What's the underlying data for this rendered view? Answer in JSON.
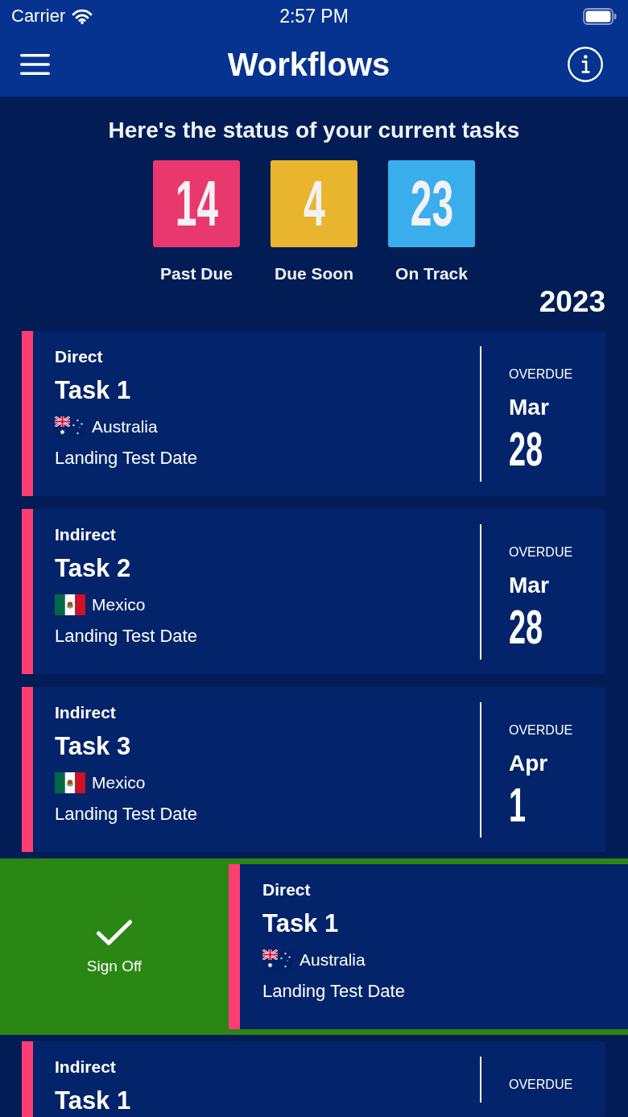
{
  "status_bar": {
    "carrier": "Carrier",
    "time": "2:57 PM"
  },
  "header": {
    "title": "Workflows"
  },
  "summary": {
    "heading": "Here's the status of your current tasks",
    "counters": [
      {
        "count": "14",
        "label": "Past Due",
        "color": "#e8386d"
      },
      {
        "count": "4",
        "label": "Due Soon",
        "color": "#e9b42e"
      },
      {
        "count": "23",
        "label": "On Track",
        "color": "#3aaeec"
      }
    ],
    "year": "2023"
  },
  "tasks": [
    {
      "type": "Direct",
      "title": "Task 1",
      "country": {
        "kind": "australia",
        "name": "Australia"
      },
      "detail": "Landing Test Date",
      "due": {
        "status": "OVERDUE",
        "month": "Mar",
        "day": "28"
      },
      "swiped": false
    },
    {
      "type": "Indirect",
      "title": "Task 2",
      "country": {
        "kind": "mexico",
        "name": "Mexico"
      },
      "detail": "Landing Test Date",
      "due": {
        "status": "OVERDUE",
        "month": "Mar",
        "day": "28"
      },
      "swiped": false
    },
    {
      "type": "Indirect",
      "title": "Task 3",
      "country": {
        "kind": "mexico",
        "name": "Mexico"
      },
      "detail": "Landing Test Date",
      "due": {
        "status": "OVERDUE",
        "month": "Apr",
        "day": "1"
      },
      "swiped": false
    },
    {
      "type": "Direct",
      "title": "Task 1",
      "country": {
        "kind": "australia",
        "name": "Australia"
      },
      "detail": "Landing Test Date",
      "swiped": true,
      "swipe_action": "Sign Off"
    },
    {
      "type": "Indirect",
      "title": "Task 1",
      "due": {
        "status": "OVERDUE"
      },
      "swiped": false
    }
  ]
}
